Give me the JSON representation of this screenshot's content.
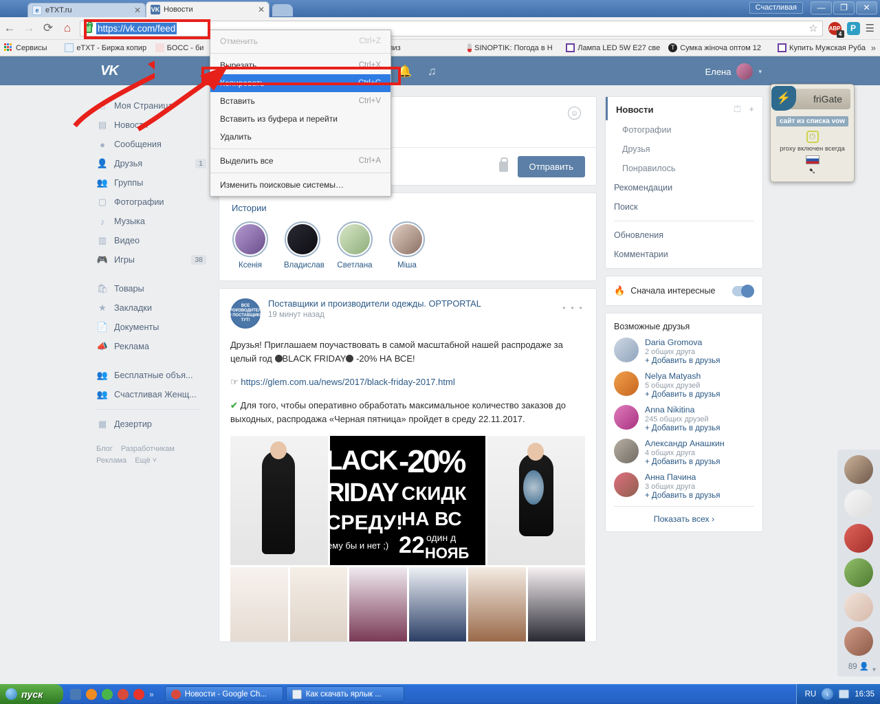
{
  "window": {
    "title_chip": "Счастливая",
    "minimize": "—",
    "restore": "❐",
    "close": "✕"
  },
  "tabs": [
    {
      "label": "eTXT.ru",
      "favicon": "etxt-icon",
      "close": "✕",
      "active": false
    },
    {
      "label": "Новости",
      "favicon": "vk-icon",
      "close": "✕",
      "active": true
    }
  ],
  "toolbar": {
    "back": "←",
    "forward": "→",
    "reload": "⟳",
    "home": "⌂",
    "url": "https://vk.com/feed",
    "lock": "secure-lock-icon",
    "star": "☆",
    "adblock_label": "ABP",
    "adblock_count": "4",
    "pocket_label": "P",
    "menu": "☰"
  },
  "bookmarks": [
    {
      "label": "Сервисы",
      "icon": "apps-grid-icon"
    },
    {
      "label": "eTXT - Биржа копир",
      "icon": "etxt-icon"
    },
    {
      "label": "БОСС - би",
      "icon": "boss-icon"
    },
    {
      "label": "анализ",
      "icon": "analysis-icon"
    },
    {
      "label": "SINOPTIK: Погода в Н",
      "icon": "thermometer-icon"
    },
    {
      "label": "Лампа LED 5W E27 све",
      "icon": "square-icon"
    },
    {
      "label": "Сумка жіноча оптом 12",
      "icon": "circle-t-icon"
    },
    {
      "label": "Купить Мужская Руба",
      "icon": "square-icon"
    }
  ],
  "bookmarks_overflow": "»",
  "context_menu": {
    "items": [
      {
        "label": "Отменить",
        "accel": "Ctrl+Z",
        "state": "disabled"
      },
      {
        "label": "Вырезать",
        "accel": "Ctrl+X",
        "state": "normal"
      },
      {
        "label": "Копировать",
        "accel": "Ctrl+C",
        "state": "selected"
      },
      {
        "label": "Вставить",
        "accel": "Ctrl+V",
        "state": "normal"
      },
      {
        "label": "Вставить из буфера и перейти",
        "accel": "",
        "state": "normal"
      },
      {
        "label": "Удалить",
        "accel": "",
        "state": "normal"
      },
      {
        "label": "Выделить все",
        "accel": "Ctrl+A",
        "state": "normal"
      },
      {
        "label": "Изменить поисковые системы…",
        "accel": "",
        "state": "normal"
      }
    ]
  },
  "vk": {
    "logo": "VK",
    "header_icons": [
      "search-icon",
      "bell-icon",
      "music-icon"
    ],
    "user_name": "Елена",
    "user_caret": "▾",
    "left_nav": [
      {
        "label": "Моя Страница",
        "icon": "home-icon",
        "badge": ""
      },
      {
        "label": "Новости",
        "icon": "news-icon",
        "badge": ""
      },
      {
        "label": "Сообщения",
        "icon": "message-icon",
        "badge": ""
      },
      {
        "label": "Друзья",
        "icon": "person-icon",
        "badge": "1"
      },
      {
        "label": "Группы",
        "icon": "people-icon",
        "badge": ""
      },
      {
        "label": "Фотографии",
        "icon": "camera-icon",
        "badge": ""
      },
      {
        "label": "Музыка",
        "icon": "note-icon",
        "badge": ""
      },
      {
        "label": "Видео",
        "icon": "film-icon",
        "badge": ""
      },
      {
        "label": "Игры",
        "icon": "gamepad-icon",
        "badge": "38"
      }
    ],
    "left_nav2": [
      {
        "label": "Товары",
        "icon": "bag-icon",
        "badge": ""
      },
      {
        "label": "Закладки",
        "icon": "star-icon",
        "badge": ""
      },
      {
        "label": "Документы",
        "icon": "doc-icon",
        "badge": ""
      },
      {
        "label": "Реклама",
        "icon": "megaphone-icon",
        "badge": ""
      }
    ],
    "left_nav3": [
      {
        "label": "Бесплатные объя...",
        "icon": "people-icon",
        "badge": ""
      },
      {
        "label": "Счастливая Женщ...",
        "icon": "people-icon",
        "badge": ""
      }
    ],
    "left_nav4": [
      {
        "label": "Дезертир",
        "icon": "apps-icon",
        "badge": ""
      }
    ],
    "footer_links": [
      "Блог",
      "Разработчикам",
      "Реклама",
      "Ещё ˅"
    ],
    "composer": {
      "smiley": "smiley-icon",
      "lock": "privacy-lock-icon",
      "send_label": "Отправить"
    },
    "stories": {
      "title": "Истории",
      "items": [
        {
          "name": "Ксенія",
          "color1": "#b49ad0",
          "color2": "#6a4f8c"
        },
        {
          "name": "Владислав",
          "color1": "#2a2a33",
          "color2": "#0d0d12"
        },
        {
          "name": "Светлана",
          "color1": "#d8e6c8",
          "color2": "#8fae7a"
        },
        {
          "name": "Міша",
          "color1": "#e2cfc4",
          "color2": "#8a6f63"
        }
      ]
    },
    "post": {
      "avatar_text": "ВСЕ ПРОИЗВОДИТЕЛИ И ПОСТАВЩИКИ ТУТ!",
      "author": "Поставщики и производители одежды. OPTPORTAL",
      "time": "19 минут назад",
      "more": "• • •",
      "body_line1": "Друзья! Приглашаем поучаствовать в самой масштабной нашей распродаже за целый год ",
      "body_brand": "BLACK FRIDAY",
      "body_line1b": " -20% НА ВСЕ!",
      "link": "https://glem.com.ua/news/2017/black-friday-2017.html",
      "link_emoji": "☞",
      "check_emoji": "✔",
      "body_line2": "Для того, чтобы оперативно обработать максимальное количество заказов до выходных, распродажа «Черная пятница» пройдет в среду 22.11.2017.",
      "banner_lines": [
        "LACK",
        "-20%",
        "RIDAY",
        "СКИДК",
        "СРЕДУ!",
        "НА ВС",
        "ему бы и нет ;)",
        "22",
        "один д",
        "НОЯБ"
      ]
    },
    "right": {
      "feed_title": "Новости",
      "filter_icon": "filter-icon",
      "add_icon": "plus-icon",
      "sub_items": [
        "Фотографии",
        "Друзья",
        "Понравилось"
      ],
      "items": [
        "Рекомендации",
        "Поиск"
      ],
      "items2": [
        "Обновления",
        "Комментарии"
      ],
      "toggle": {
        "label": "Сначала интересные",
        "fire_icon": "fire-icon",
        "state": "on"
      },
      "suggestions_title": "Возможные друзья",
      "add_label": "Добавить в друзья",
      "add_plus": "+",
      "friends": [
        {
          "name": "Daria Gromova",
          "mutual": "2 общих друга",
          "c1": "#cfd8e3",
          "c2": "#8fa3bd"
        },
        {
          "name": "Nelya Matyash",
          "mutual": "5 общих друзей",
          "c1": "#f0a04b",
          "c2": "#c7651f"
        },
        {
          "name": "Anna Nikitina",
          "mutual": "245 общих друзей",
          "c1": "#e07bbd",
          "c2": "#a8327f"
        },
        {
          "name": "Александр Анашкин",
          "mutual": "4 общих друга",
          "c1": "#b9b0a4",
          "c2": "#6f6a62"
        },
        {
          "name": "Анна Пачина",
          "mutual": "3 общих друга",
          "c1": "#e0707f",
          "c2": "#8d5f4d"
        }
      ],
      "show_all": "Показать всех",
      "show_all_caret": "›"
    },
    "online_strip": {
      "count": "89",
      "person_icon": "person-icon",
      "caret": "▾",
      "avatars": [
        {
          "c1": "#cbb39a",
          "c2": "#6f584a"
        },
        {
          "c1": "#f2f2f2",
          "c2": "#d8d8d8"
        },
        {
          "c1": "#e0645c",
          "c2": "#a32f2a"
        },
        {
          "c1": "#93c06a",
          "c2": "#4d7a2f"
        },
        {
          "c1": "#f2e3da",
          "c2": "#d6b9a9"
        },
        {
          "c1": "#cf9b86",
          "c2": "#8d5a48"
        }
      ]
    }
  },
  "frigate": {
    "title": "friGate",
    "icon": "frigate-bolt-icon",
    "pill": "сайт из списка vow",
    "power_icon": "power-icon",
    "status": "proxy включен всегда",
    "flag": "ru-flag-icon",
    "arrow": "➷"
  },
  "taskbar": {
    "start_label": "пуск",
    "start_icon": "windows-orb-icon",
    "quick_launch": [
      {
        "name": "show-desktop-icon",
        "color": "#4a7ab5"
      },
      {
        "name": "avast-icon",
        "color": "#ef8b23"
      },
      {
        "name": "utorrent-icon",
        "color": "#4ab54a"
      },
      {
        "name": "chrome-icon",
        "color": "#d94a3d"
      },
      {
        "name": "yandex-icon",
        "color": "#e8342a"
      }
    ],
    "quick_chevron": "»",
    "tasks": [
      {
        "label": "Новости - Google Ch...",
        "icon": "chrome-icon"
      },
      {
        "label": "Как скачать ярлык ...",
        "icon": "word-icon"
      }
    ],
    "tray": {
      "language": "RU",
      "chevron": "‹",
      "network_icon": "network-icon",
      "clock": "16:35"
    }
  }
}
